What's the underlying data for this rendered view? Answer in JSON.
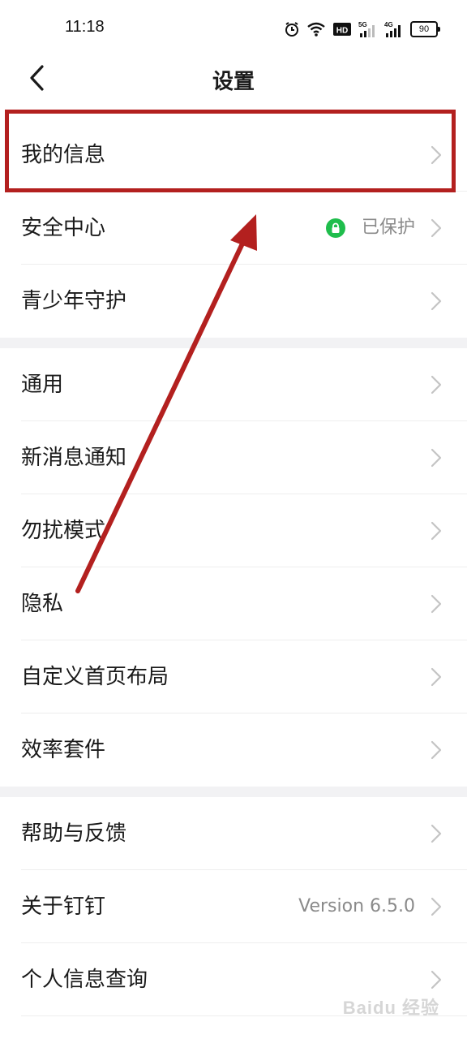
{
  "status_bar": {
    "time": "11:18",
    "icons": [
      "alarm-icon",
      "wifi-icon",
      "hd-icon",
      "signal-5g-icon",
      "signal-4g-icon"
    ],
    "battery": "90"
  },
  "nav": {
    "title": "设置",
    "back_icon": "chevron-left-icon"
  },
  "groups": [
    {
      "items": [
        {
          "label": "我的信息"
        },
        {
          "label": "安全中心",
          "status": "已保护",
          "status_icon": "lock-icon"
        },
        {
          "label": "青少年守护"
        }
      ]
    },
    {
      "items": [
        {
          "label": "通用"
        },
        {
          "label": "新消息通知"
        },
        {
          "label": "勿扰模式"
        },
        {
          "label": "隐私"
        },
        {
          "label": "自定义首页布局"
        },
        {
          "label": "效率套件"
        }
      ]
    },
    {
      "items": [
        {
          "label": "帮助与反馈"
        },
        {
          "label": "关于钉钉",
          "value": "Version 6.5.0"
        },
        {
          "label": "个人信息查询"
        }
      ]
    }
  ],
  "annotation_colors": {
    "highlight": "#b3201f",
    "badge": "#1fbd4c"
  },
  "watermark": "Baidu 经验"
}
